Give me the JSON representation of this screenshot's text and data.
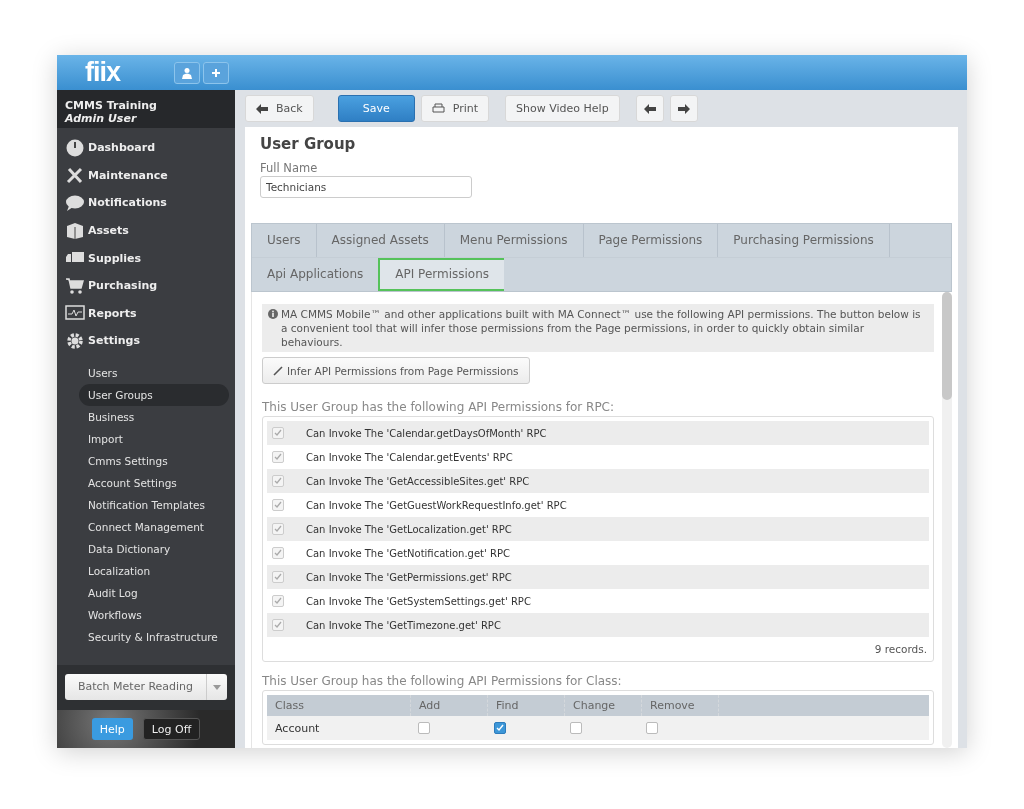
{
  "header": {
    "logo": "fiix"
  },
  "account": {
    "name": "CMMS Training",
    "role": "Admin User"
  },
  "nav": [
    {
      "label": "Dashboard"
    },
    {
      "label": "Maintenance"
    },
    {
      "label": "Notifications"
    },
    {
      "label": "Assets"
    },
    {
      "label": "Supplies"
    },
    {
      "label": "Purchasing"
    },
    {
      "label": "Reports"
    },
    {
      "label": "Settings"
    }
  ],
  "settings_items": [
    {
      "label": "Users",
      "selected": false
    },
    {
      "label": "User Groups",
      "selected": true
    },
    {
      "label": "Business",
      "selected": false
    },
    {
      "label": "Import",
      "selected": false
    },
    {
      "label": "Cmms Settings",
      "selected": false
    },
    {
      "label": "Account Settings",
      "selected": false
    },
    {
      "label": "Notification Templates",
      "selected": false
    },
    {
      "label": "Connect Management",
      "selected": false
    },
    {
      "label": "Data Dictionary",
      "selected": false
    },
    {
      "label": "Localization",
      "selected": false
    },
    {
      "label": "Audit Log",
      "selected": false
    },
    {
      "label": "Workflows",
      "selected": false
    },
    {
      "label": "Security & Infrastructure",
      "selected": false
    }
  ],
  "batch_button": "Batch Meter Reading",
  "footer_buttons": [
    {
      "label": "Help",
      "kind": "primary"
    },
    {
      "label": "Log Off",
      "kind": "dark"
    }
  ],
  "toolbar": [
    {
      "label": "Back",
      "kind": "back"
    },
    {
      "label": "Save",
      "kind": "primary"
    },
    {
      "label": "Print",
      "kind": "print"
    },
    {
      "label": "Show Video Help",
      "kind": "plain"
    },
    {
      "kind": "prev"
    },
    {
      "kind": "next"
    }
  ],
  "title": "User Group",
  "full_name": {
    "label": "Full Name",
    "value": "Technicians"
  },
  "tabs": [
    [
      {
        "label": "Users",
        "selected": false
      },
      {
        "label": "Assigned Assets",
        "selected": false
      },
      {
        "label": "Menu Permissions",
        "selected": false
      },
      {
        "label": "Page Permissions",
        "selected": false
      },
      {
        "label": "Purchasing Permissions",
        "selected": false
      }
    ],
    [
      {
        "label": "Api Applications",
        "selected": false
      },
      {
        "label": "API Permissions",
        "selected": true
      }
    ]
  ],
  "info": "MA CMMS Mobile™ and other applications built with MA Connect™ use the following API permissions. The button below is a convenient tool that will infer those permissions from the Page permissions, in order to quickly obtain similar behaviours.",
  "infer_button": "Infer API Permissions from Page Permissions",
  "rpc": {
    "heading": "This User Group has the following API Permissions for RPC:",
    "rows": [
      {
        "label": "Can Invoke The 'Calendar.getDaysOfMonth' RPC",
        "checked": true
      },
      {
        "label": "Can Invoke The 'Calendar.getEvents' RPC",
        "checked": true
      },
      {
        "label": "Can Invoke The 'GetAccessibleSites.get' RPC",
        "checked": true
      },
      {
        "label": "Can Invoke The 'GetGuestWorkRequestInfo.get' RPC",
        "checked": true
      },
      {
        "label": "Can Invoke The 'GetLocalization.get' RPC",
        "checked": true
      },
      {
        "label": "Can Invoke The 'GetNotification.get' RPC",
        "checked": true
      },
      {
        "label": "Can Invoke The 'GetPermissions.get' RPC",
        "checked": true
      },
      {
        "label": "Can Invoke The 'GetSystemSettings.get' RPC",
        "checked": true
      },
      {
        "label": "Can Invoke The 'GetTimezone.get' RPC",
        "checked": true
      }
    ],
    "count": "9 records."
  },
  "class": {
    "heading": "This User Group has the following API Permissions for Class:",
    "columns": [
      "Class",
      "Add",
      "Find",
      "Change",
      "Remove"
    ],
    "rows": [
      {
        "name": "Account",
        "add": false,
        "find": true,
        "change": false,
        "remove": false
      }
    ]
  }
}
